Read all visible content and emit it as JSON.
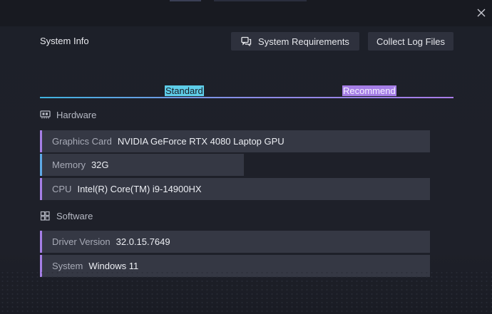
{
  "header": {
    "title": "System Info",
    "system_requirements_label": "System Requirements",
    "collect_logs_label": "Collect Log Files"
  },
  "tabs": [
    {
      "label": "Standard",
      "color": "#5ecde8"
    },
    {
      "label": "Recommend",
      "color": "#a67fe6"
    }
  ],
  "hardware": {
    "title": "Hardware",
    "rows": [
      {
        "label": "Graphics Card",
        "value": "NVIDIA GeForce RTX 4080 Laptop GPU",
        "accent": "#a67fe6"
      },
      {
        "label": "Memory",
        "value": "32G",
        "accent": "#5ea9e6"
      },
      {
        "label": "CPU",
        "value": "Intel(R) Core(TM) i9-14900HX",
        "accent": "#a67fe6"
      }
    ]
  },
  "software": {
    "title": "Software",
    "rows": [
      {
        "label": "Driver Version",
        "value": "32.0.15.7649",
        "accent": "#a67fe6"
      },
      {
        "label": "System",
        "value": "Windows 11",
        "accent": "#a67fe6"
      }
    ]
  },
  "icons": {
    "close": "close-icon",
    "system_requirements": "chat-bubbles-icon",
    "hardware": "graphics-card-icon",
    "software": "windows-logo-icon"
  }
}
